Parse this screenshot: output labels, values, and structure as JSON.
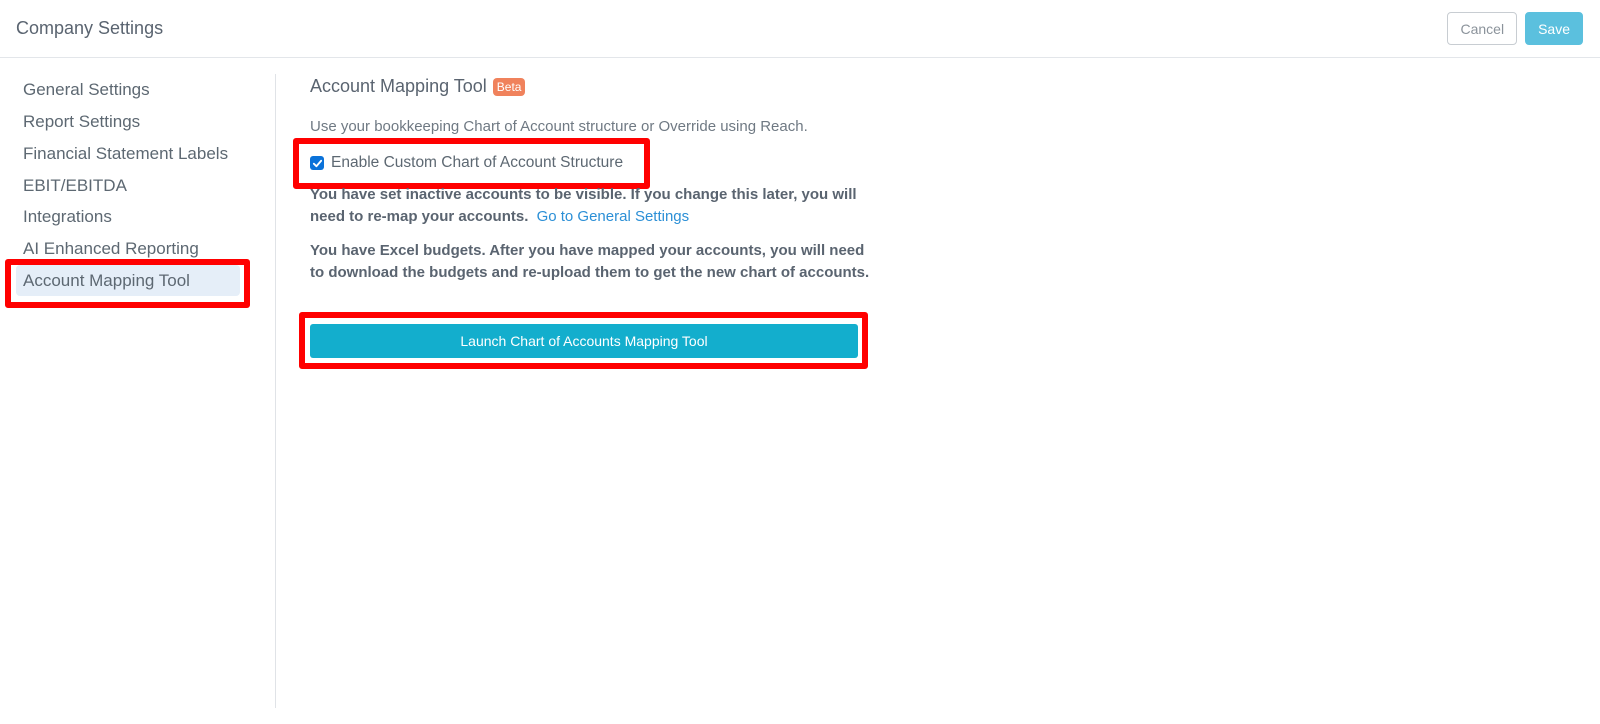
{
  "header": {
    "title": "Company Settings",
    "cancel_label": "Cancel",
    "save_label": "Save"
  },
  "sidebar": {
    "items": [
      {
        "label": "General Settings"
      },
      {
        "label": "Report Settings"
      },
      {
        "label": "Financial Statement Labels"
      },
      {
        "label": "EBIT/EBITDA"
      },
      {
        "label": "Integrations"
      },
      {
        "label": "AI Enhanced Reporting"
      },
      {
        "label": "Account Mapping Tool"
      }
    ],
    "active_item": "Account Mapping Tool"
  },
  "main": {
    "title": "Account Mapping Tool",
    "badge": "Beta",
    "description": "Use your bookkeeping Chart of Account structure or Override using Reach.",
    "checkbox_label": "Enable Custom Chart of Account Structure",
    "checkbox_checked": true,
    "notice1": "You have set inactive accounts to be visible. If you change this later, you will need to re-map your accounts.",
    "notice1_link": "Go to General Settings",
    "notice2": "You have Excel budgets. After you have mapped your accounts, you will need to download the budgets and re-upload them to get the new chart of accounts.",
    "launch_label": "Launch Chart of Accounts Mapping Tool"
  },
  "colors": {
    "accent": "#13aecd",
    "save": "#5bc0de",
    "badge": "#f0825c",
    "highlight": "#ff0000",
    "link": "#2b8fd6"
  }
}
